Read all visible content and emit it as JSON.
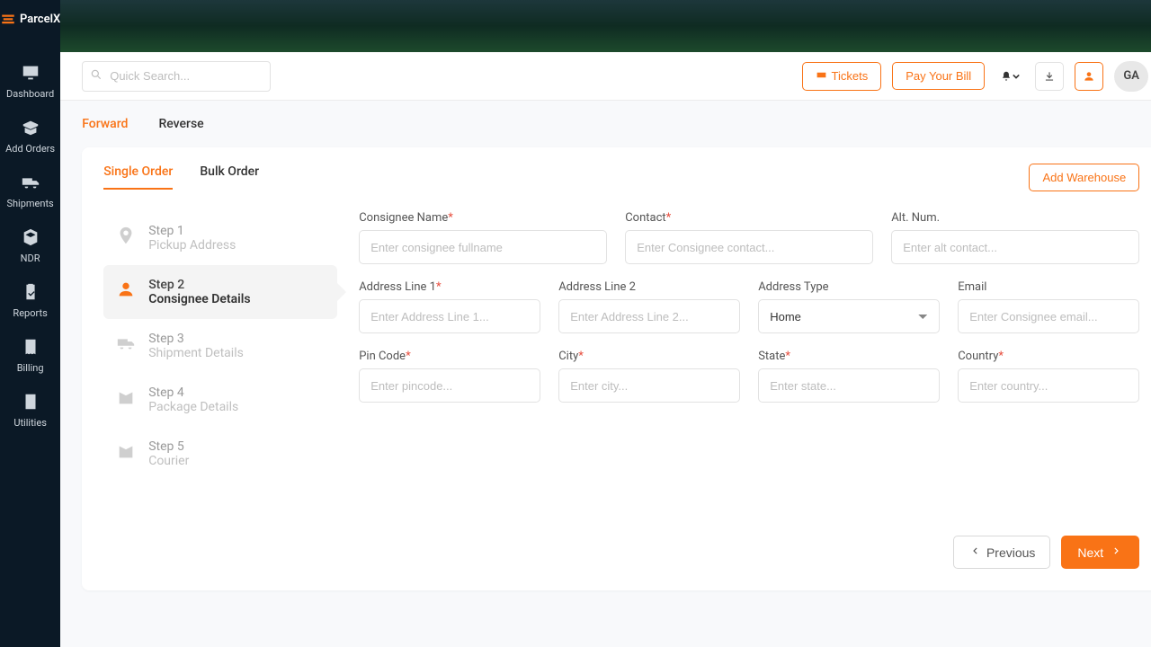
{
  "brand": {
    "name": "ParcelX"
  },
  "sidebar": {
    "items": [
      {
        "label": "Dashboard"
      },
      {
        "label": "Add Orders"
      },
      {
        "label": "Shipments"
      },
      {
        "label": "NDR"
      },
      {
        "label": "Reports"
      },
      {
        "label": "Billing"
      },
      {
        "label": "Utilities"
      }
    ]
  },
  "topbar": {
    "search_placeholder": "Quick Search...",
    "tickets_label": "Tickets",
    "pay_bill_label": "Pay Your Bill",
    "avatar_initials": "GA"
  },
  "top_tabs": {
    "forward": "Forward",
    "reverse": "Reverse"
  },
  "card": {
    "inner_tabs": {
      "single": "Single Order",
      "bulk": "Bulk Order"
    },
    "add_warehouse_label": "Add Warehouse"
  },
  "steps": [
    {
      "title": "Step 1",
      "sub": "Pickup Address"
    },
    {
      "title": "Step 2",
      "sub": "Consignee Details"
    },
    {
      "title": "Step 3",
      "sub": "Shipment Details"
    },
    {
      "title": "Step 4",
      "sub": "Package Details"
    },
    {
      "title": "Step 5",
      "sub": "Courier"
    }
  ],
  "form": {
    "consignee_name": {
      "label": "Consignee Name",
      "placeholder": "Enter consignee fullname"
    },
    "contact": {
      "label": "Contact",
      "placeholder": "Enter Consignee contact..."
    },
    "alt_num": {
      "label": "Alt. Num.",
      "placeholder": "Enter alt contact..."
    },
    "address1": {
      "label": "Address Line 1",
      "placeholder": "Enter Address Line 1..."
    },
    "address2": {
      "label": "Address Line 2",
      "placeholder": "Enter Address Line 2..."
    },
    "address_type": {
      "label": "Address Type",
      "value": "Home"
    },
    "email": {
      "label": "Email",
      "placeholder": "Enter Consignee email..."
    },
    "pincode": {
      "label": "Pin Code",
      "placeholder": "Enter pincode..."
    },
    "city": {
      "label": "City",
      "placeholder": "Enter city..."
    },
    "state": {
      "label": "State",
      "placeholder": "Enter state..."
    },
    "country": {
      "label": "Country",
      "placeholder": "Enter country..."
    }
  },
  "footer": {
    "previous": "Previous",
    "next": "Next"
  }
}
